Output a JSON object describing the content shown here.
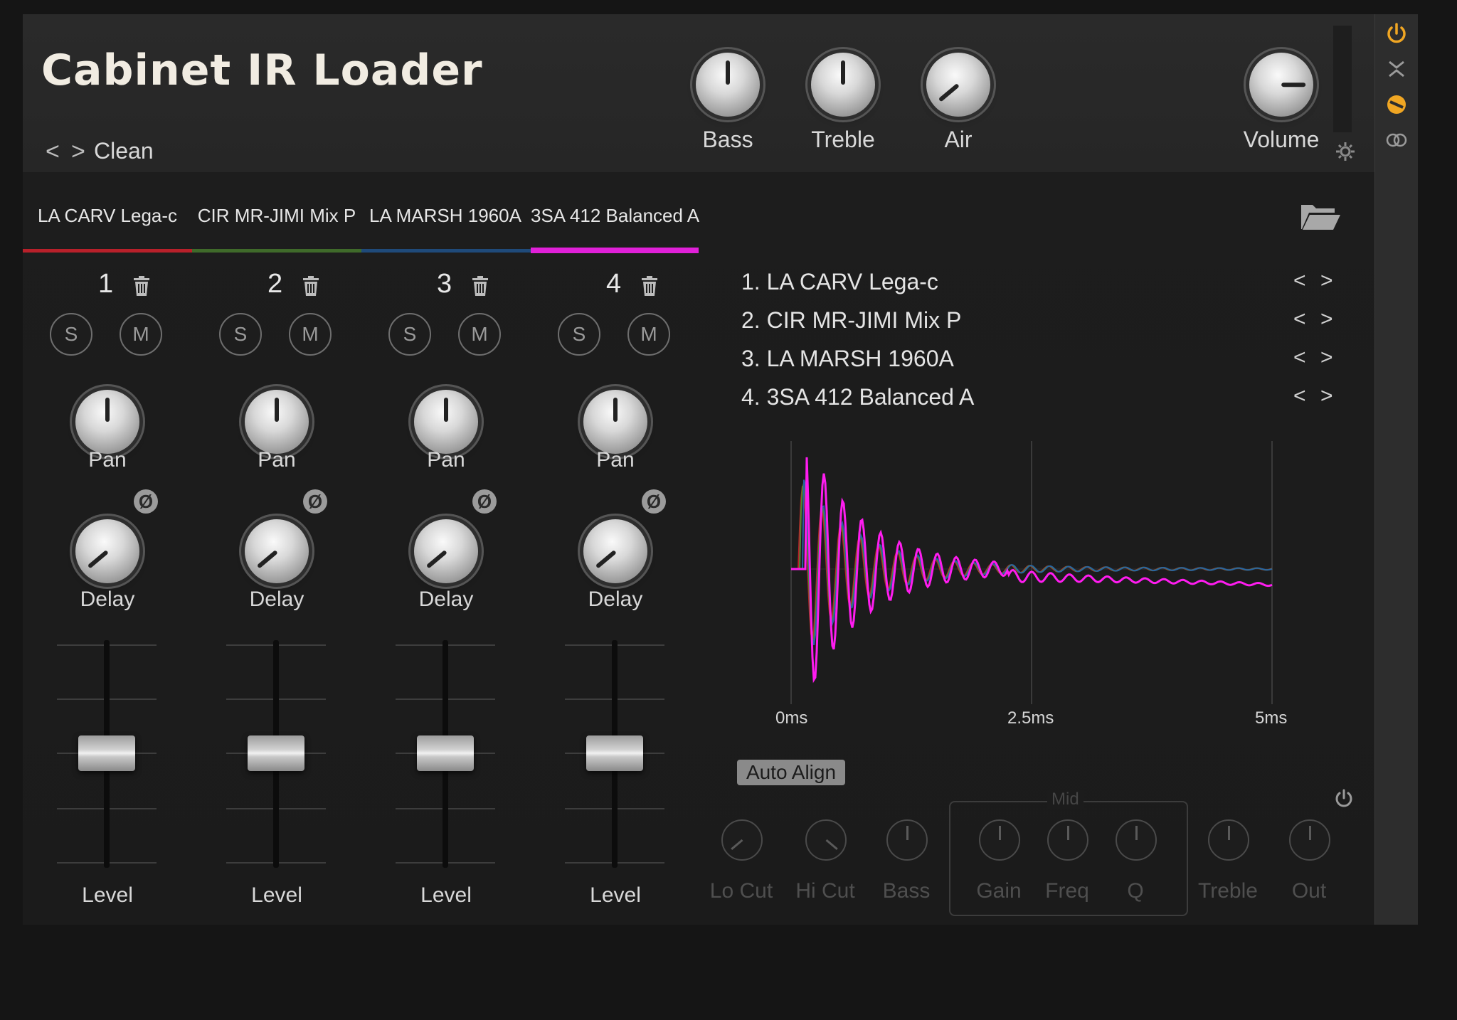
{
  "header": {
    "title": "Cabinet IR Loader",
    "preset": {
      "name": "Clean",
      "prev": "<",
      "next": ">"
    },
    "knobs": [
      {
        "id": "bass",
        "label": "Bass"
      },
      {
        "id": "treble",
        "label": "Treble"
      },
      {
        "id": "air",
        "label": "Air"
      },
      {
        "id": "volume",
        "label": "Volume"
      }
    ]
  },
  "tabs": [
    {
      "label": "LA CARV Lega-c",
      "color": "#b8202a"
    },
    {
      "label": "CIR MR-JIMI Mix P",
      "color": "#3f6a2a"
    },
    {
      "label": "LA MARSH 1960A",
      "color": "#1f4a7a"
    },
    {
      "label": "3SA 412 Balanced A",
      "color": "#e020d8",
      "active": true
    }
  ],
  "channels": [
    {
      "number": "1",
      "solo": "S",
      "mute": "M",
      "pan": "Pan",
      "phase": "Ø",
      "delay": "Delay",
      "level": "Level"
    },
    {
      "number": "2",
      "solo": "S",
      "mute": "M",
      "pan": "Pan",
      "phase": "Ø",
      "delay": "Delay",
      "level": "Level"
    },
    {
      "number": "3",
      "solo": "S",
      "mute": "M",
      "pan": "Pan",
      "phase": "Ø",
      "delay": "Delay",
      "level": "Level"
    },
    {
      "number": "4",
      "solo": "S",
      "mute": "M",
      "pan": "Pan",
      "phase": "Ø",
      "delay": "Delay",
      "level": "Level"
    }
  ],
  "ir_list": [
    {
      "label": "1. LA CARV Lega-c",
      "prev": "<",
      "next": ">"
    },
    {
      "label": "2. CIR MR-JIMI Mix P",
      "prev": "<",
      "next": ">"
    },
    {
      "label": "3. LA MARSH 1960A",
      "prev": "<",
      "next": ">"
    },
    {
      "label": "4. 3SA 412 Balanced A",
      "prev": "<",
      "next": ">"
    }
  ],
  "waveform": {
    "axis_labels": [
      "0ms",
      "2.5ms",
      "5ms"
    ],
    "series_colors": [
      "#b8202a",
      "#4e8a32",
      "#2a64a0",
      "#ff1cf0"
    ]
  },
  "auto_align": "Auto Align",
  "eq": {
    "mid_group_label": "Mid",
    "knobs": [
      {
        "id": "lo-cut",
        "label": "Lo Cut"
      },
      {
        "id": "hi-cut",
        "label": "Hi Cut"
      },
      {
        "id": "eq-bass",
        "label": "Bass"
      },
      {
        "id": "gain",
        "label": "Gain"
      },
      {
        "id": "freq",
        "label": "Freq"
      },
      {
        "id": "q",
        "label": "Q"
      },
      {
        "id": "eq-treble",
        "label": "Treble"
      },
      {
        "id": "out",
        "label": "Out"
      }
    ]
  },
  "sidebar": {
    "icons": [
      "power-icon",
      "collapse-icon",
      "no-entry-icon",
      "stereo-link-icon"
    ],
    "accent": "#f0a623"
  }
}
